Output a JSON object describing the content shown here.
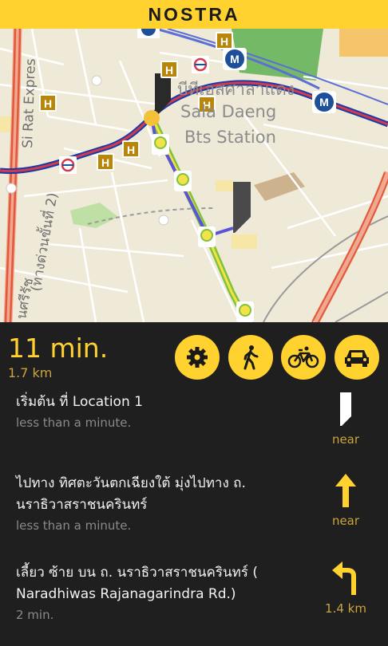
{
  "header": {
    "logo_text": "NOSTRA"
  },
  "map": {
    "station_label_thai": "บีทีเอสศาลาแดง",
    "station_label_line1": "Sala Daeng",
    "station_label_line2": "Bts Station",
    "road_label_left_top": "Si Rat Expres",
    "road_label_left_mid": "(ทางด่วนขั้นที่ 2)",
    "road_label_left_bottom": "นศรีรัช",
    "metro_icon_letter": "M",
    "hotel_icon_letter": "H"
  },
  "summary": {
    "duration": "11 min.",
    "distance": "1.7 km"
  },
  "modes": [
    {
      "name": "settings"
    },
    {
      "name": "walk"
    },
    {
      "name": "bicycle"
    },
    {
      "name": "car"
    }
  ],
  "steps": [
    {
      "instruction": "เริ่มต้น ที่ Location 1",
      "time": "less than a minute.",
      "distance": "near",
      "icon": "start-flag-icon"
    },
    {
      "instruction": "ไปทาง ทิศตะวันตกเฉียงใต้ มุ่งไปทาง ถ. นราธิวาสราชนครินทร์",
      "time": "less than a minute.",
      "distance": "near",
      "icon": "arrow-up-icon"
    },
    {
      "instruction": "เลี้ยว ซ้าย บน ถ. นราธิวาสราชนครินทร์ ( Naradhiwas Rajanagarindra Rd.)",
      "time": "2 min.",
      "distance": "1.4 km",
      "icon": "turn-left-icon"
    }
  ],
  "colors": {
    "accent": "#ffd22f",
    "panel_bg": "#1f1f1f",
    "route_blue": "#5a55d6",
    "bts_green": "#7fc33b",
    "mrt_line": "#d43a4a"
  }
}
